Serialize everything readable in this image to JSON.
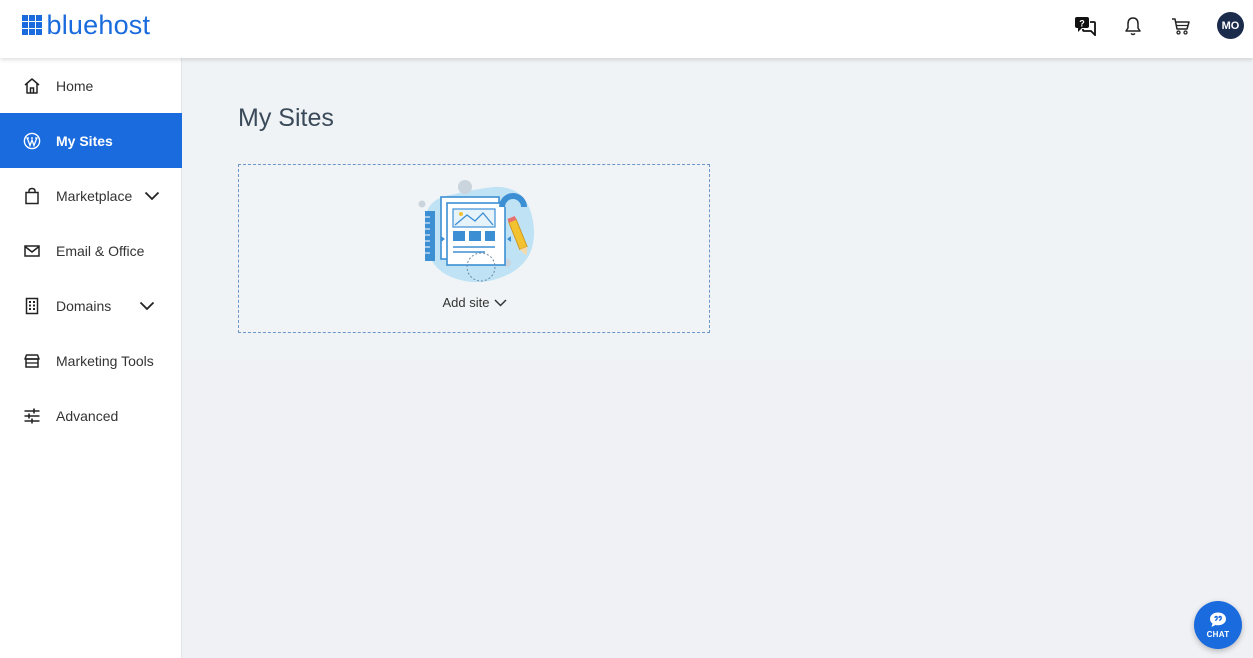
{
  "header": {
    "logo_text": "bluehost",
    "avatar_initials": "MO",
    "icons": [
      "help-chat-icon",
      "bell-icon",
      "cart-icon"
    ]
  },
  "sidebar": {
    "items": [
      {
        "label": "Home",
        "icon": "home-icon"
      },
      {
        "label": "My Sites",
        "icon": "wordpress-icon",
        "active": true
      },
      {
        "label": "Marketplace",
        "icon": "bag-icon",
        "has_dropdown": true
      },
      {
        "label": "Email & Office",
        "icon": "envelope-icon"
      },
      {
        "label": "Domains",
        "icon": "building-icon",
        "has_dropdown": true
      },
      {
        "label": "Marketing Tools",
        "icon": "storefront-icon"
      },
      {
        "label": "Advanced",
        "icon": "sliders-icon"
      }
    ]
  },
  "main": {
    "title": "My Sites",
    "add_site_label": "Add site"
  },
  "chat": {
    "label": "CHAT"
  },
  "colors": {
    "brand": "#196bde",
    "avatar": "#1a2b4b",
    "band": "#eff3f5",
    "background": "#f0f1f5"
  }
}
